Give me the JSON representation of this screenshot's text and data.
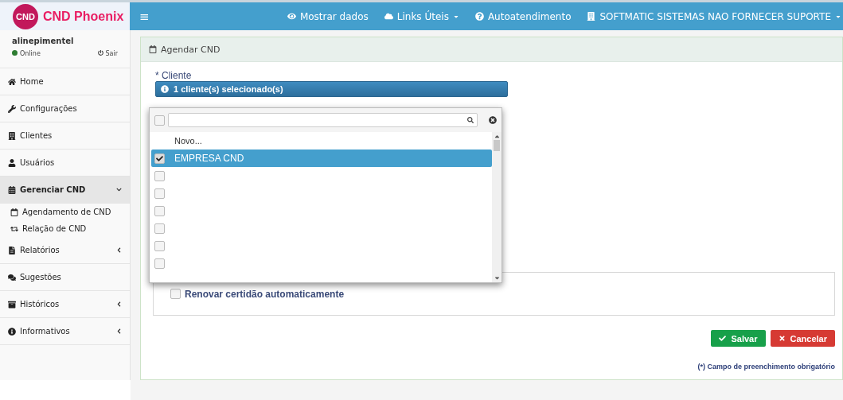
{
  "brand": {
    "logo": "CND",
    "name": "CND Phoenix"
  },
  "topbar": {
    "menu_icon": "≡",
    "items": [
      {
        "kind": "eye",
        "label": "Mostrar dados",
        "caret": false
      },
      {
        "kind": "cloud",
        "label": "Links Úteis",
        "caret": true
      },
      {
        "kind": "help",
        "label": "Autoatendimento",
        "caret": false
      },
      {
        "kind": "building",
        "label": "SOFTMATIC SISTEMAS NAO FORNECER SUPORTE",
        "caret": true
      }
    ]
  },
  "user": {
    "name": "alinepimentel",
    "status": "Online",
    "logout": "Sair"
  },
  "sidebar": {
    "items": [
      {
        "label": "Home",
        "expanded": false,
        "has_children": false
      },
      {
        "label": "Configurações",
        "expanded": false,
        "has_children": false
      },
      {
        "label": "Clientes",
        "expanded": false,
        "has_children": false
      },
      {
        "label": "Usuários",
        "expanded": false,
        "has_children": false
      },
      {
        "label": "Gerenciar CND",
        "expanded": true,
        "has_children": true,
        "children": [
          {
            "label": "Agendamento de CND"
          },
          {
            "label": "Relação de CND"
          }
        ]
      },
      {
        "label": "Relatórios",
        "expanded": false,
        "has_children": true
      },
      {
        "label": "Sugestões",
        "expanded": false,
        "has_children": false
      },
      {
        "label": "Históricos",
        "expanded": false,
        "has_children": true
      },
      {
        "label": "Informativos",
        "expanded": false,
        "has_children": true
      }
    ]
  },
  "panel": {
    "title": "Agendar CND",
    "client_field": {
      "label": "* Cliente",
      "value": "1 cliente(s) selecionado(s)"
    },
    "dropdown": {
      "select_all_checked": false,
      "options": [
        {
          "kind": "action",
          "label": "Novo...",
          "selected": false
        },
        {
          "kind": "option",
          "label": "EMPRESA CND",
          "checked": true,
          "selected": true
        },
        {
          "kind": "option",
          "checked": false,
          "selected": false
        },
        {
          "kind": "option",
          "checked": false,
          "selected": false
        },
        {
          "kind": "option",
          "checked": false,
          "selected": false
        },
        {
          "kind": "option",
          "checked": false,
          "selected": false
        },
        {
          "kind": "option",
          "checked": false,
          "selected": false
        },
        {
          "kind": "option",
          "checked": false,
          "selected": false
        }
      ]
    },
    "renew": {
      "label": "Renovar certidão automaticamente",
      "checked": false
    },
    "buttons": [
      {
        "kind": "save",
        "label": "Salvar"
      },
      {
        "kind": "cancel",
        "label": "Cancelar"
      }
    ],
    "footnote": "(*) Campo de preenchimento obrigatório"
  }
}
